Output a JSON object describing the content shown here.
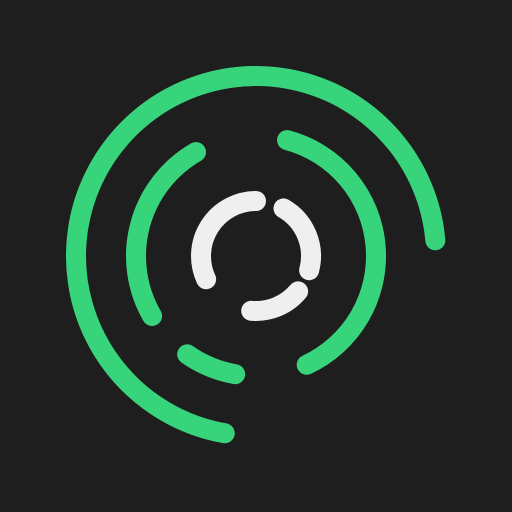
{
  "logo": {
    "icon": "concentric-dashed-rings-icon",
    "colors": {
      "background": "#1e1e1e",
      "accent": "#38d47b",
      "center": "#efefef"
    }
  }
}
